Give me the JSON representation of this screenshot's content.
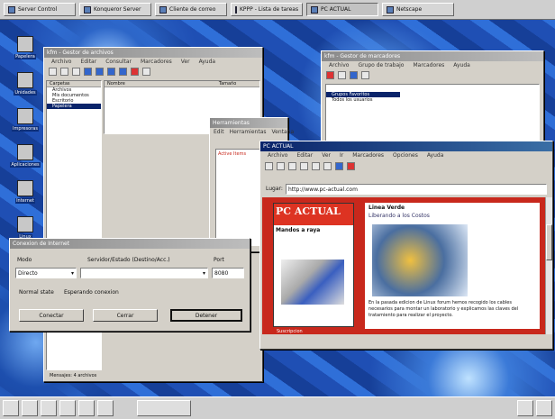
{
  "taskbar": {
    "items": [
      {
        "label": "Server Control",
        "active": false
      },
      {
        "label": "Konqueror Server",
        "active": false
      },
      {
        "label": "Cliente de correo",
        "active": false
      },
      {
        "label": "KPPP - Lista de tareas",
        "active": false
      },
      {
        "label": "PC ACTUAL",
        "active": true
      },
      {
        "label": "Netscape",
        "active": false
      }
    ]
  },
  "desktop_icons": [
    "Papelera",
    "Unidades",
    "Impresoras",
    "Aplicaciones",
    "Internet",
    "Linux"
  ],
  "colors": {
    "title_active": "#0a246a",
    "title_inactive": "#8a8a8a",
    "accent_red": "#c8281c",
    "selection": "#0a246a"
  },
  "file_manager": {
    "title": "kfm - Gestor de archivos",
    "menu": [
      "Archivo",
      "Editar",
      "Consultar",
      "Marcadores",
      "Ver",
      "Ayuda"
    ],
    "columns": [
      "Carpetas",
      "Nombre",
      "Tamaño"
    ],
    "tree": [
      "Archivos",
      "Mis documentos",
      "Escritorio",
      "Papelera"
    ],
    "selected_index": 3
  },
  "bookmarks": {
    "title": "kfm - Gestor de marcadores",
    "menu": [
      "Archivo",
      "Grupo de trabajo",
      "Marcadores",
      "Ayuda"
    ],
    "folders": [
      "Grupos Favoritos",
      "Todos los usuarios"
    ]
  },
  "small_win": {
    "title": "Herramientas",
    "menu": [
      "Edit",
      "Herramientas",
      "Ventana"
    ],
    "label": "Active Items"
  },
  "dialog": {
    "title": "Conexion de Internet",
    "headers": [
      "Modo",
      "Servidor/Estado (Destino/Acc.)",
      "Port"
    ],
    "mode_value": "Directo",
    "port_value": "8080",
    "status_label": "Normal state",
    "status_value": "Esperando conexion",
    "buttons": [
      "Conectar",
      "Cerrar",
      "Detener"
    ]
  },
  "browser": {
    "title": "PC ACTUAL",
    "menu": [
      "Archivo",
      "Editar",
      "Ver",
      "Ir",
      "Marcadores",
      "Opciones",
      "Ayuda"
    ],
    "location_label": "Lugar:",
    "url": "http://www.pc-actual.com",
    "magazine": {
      "title": "PC ACTUAL",
      "headline": "Mandos a raya"
    },
    "article": {
      "kicker": "Linea Verde",
      "heading": "Liberando a los Costos",
      "body": "En la pasada edicion de Linux forum hemos recogido los cables necesarios para montar un laboratorio y explicamos las claves del tratamiento para realizar el proyecto."
    },
    "bottom_link": "Suscripcion"
  },
  "file_manager_status": "Mensajes: 4 archivos"
}
